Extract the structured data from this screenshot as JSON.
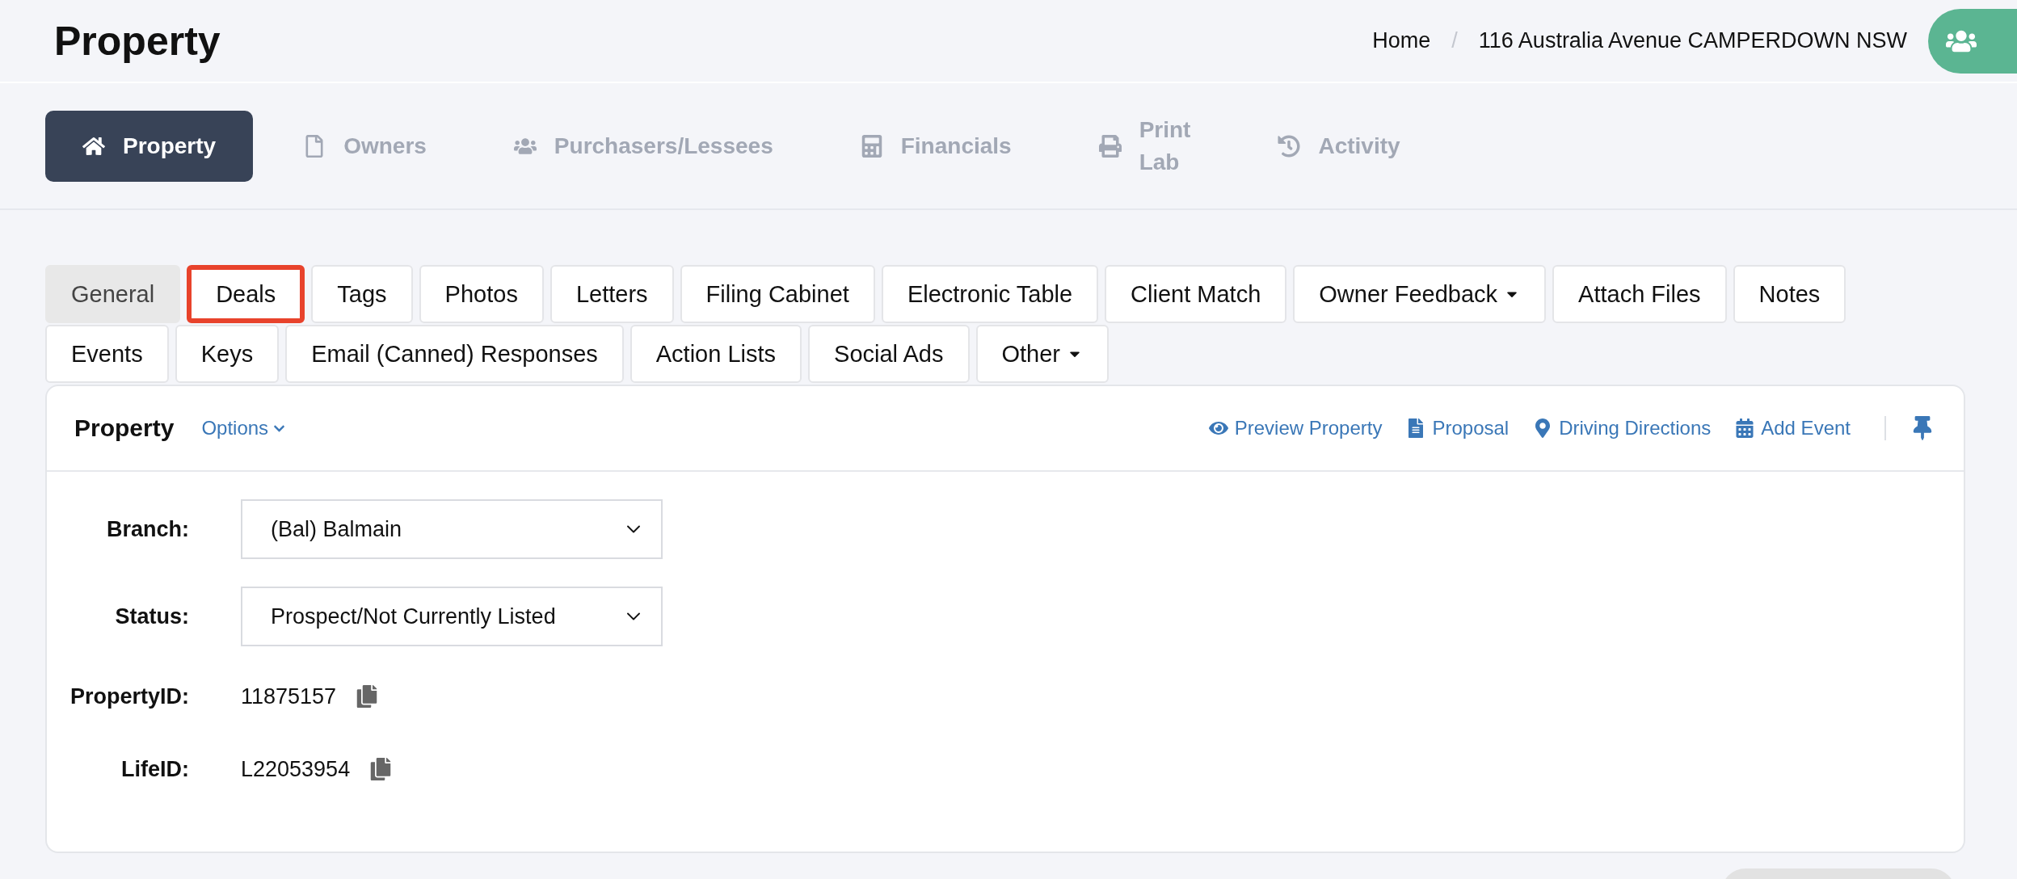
{
  "page_title": "Property",
  "breadcrumb": {
    "items": [
      "Home",
      "116 Australia Avenue CAMPERDOWN NSW"
    ],
    "separator": "/"
  },
  "main_tabs": [
    {
      "label": "Property",
      "selected": true
    },
    {
      "label": "Owners",
      "selected": false
    },
    {
      "label": "Purchasers/Lessees",
      "selected": false
    },
    {
      "label": "Financials",
      "selected": false
    },
    {
      "label": "Print Lab",
      "selected": false
    },
    {
      "label": "Activity",
      "selected": false
    }
  ],
  "sub_tab_rows": [
    [
      {
        "label": "General",
        "selected": true,
        "highlighted": false,
        "dropdown": false
      },
      {
        "label": "Deals",
        "selected": false,
        "highlighted": true,
        "dropdown": false
      },
      {
        "label": "Tags",
        "selected": false,
        "highlighted": false,
        "dropdown": false
      },
      {
        "label": "Photos",
        "selected": false,
        "highlighted": false,
        "dropdown": false
      },
      {
        "label": "Letters",
        "selected": false,
        "highlighted": false,
        "dropdown": false
      },
      {
        "label": "Filing Cabinet",
        "selected": false,
        "highlighted": false,
        "dropdown": false
      },
      {
        "label": "Electronic Table",
        "selected": false,
        "highlighted": false,
        "dropdown": false
      },
      {
        "label": "Client Match",
        "selected": false,
        "highlighted": false,
        "dropdown": false
      },
      {
        "label": "Owner Feedback",
        "selected": false,
        "highlighted": false,
        "dropdown": true
      },
      {
        "label": "Attach Files",
        "selected": false,
        "highlighted": false,
        "dropdown": false
      },
      {
        "label": "Notes",
        "selected": false,
        "highlighted": false,
        "dropdown": false
      }
    ],
    [
      {
        "label": "Events",
        "selected": false,
        "highlighted": false,
        "dropdown": false
      },
      {
        "label": "Keys",
        "selected": false,
        "highlighted": false,
        "dropdown": false
      },
      {
        "label": "Email (Canned) Responses",
        "selected": false,
        "highlighted": false,
        "dropdown": false
      },
      {
        "label": "Action Lists",
        "selected": false,
        "highlighted": false,
        "dropdown": false
      },
      {
        "label": "Social Ads",
        "selected": false,
        "highlighted": false,
        "dropdown": false
      },
      {
        "label": "Other",
        "selected": false,
        "highlighted": false,
        "dropdown": true
      }
    ]
  ],
  "panel": {
    "title": "Property",
    "options": "Options",
    "actions": [
      "Preview Property",
      "Proposal",
      "Driving Directions",
      "Add Event"
    ],
    "fields": [
      {
        "kind": "select",
        "label": "Branch:",
        "value": "(Bal) Balmain"
      },
      {
        "kind": "select",
        "label": "Status:",
        "value": "Prospect/Not Currently Listed"
      },
      {
        "kind": "copy",
        "label": "PropertyID:",
        "value": "11875157"
      },
      {
        "kind": "copy",
        "label": "LifeID:",
        "value": "L22053954"
      }
    ]
  }
}
